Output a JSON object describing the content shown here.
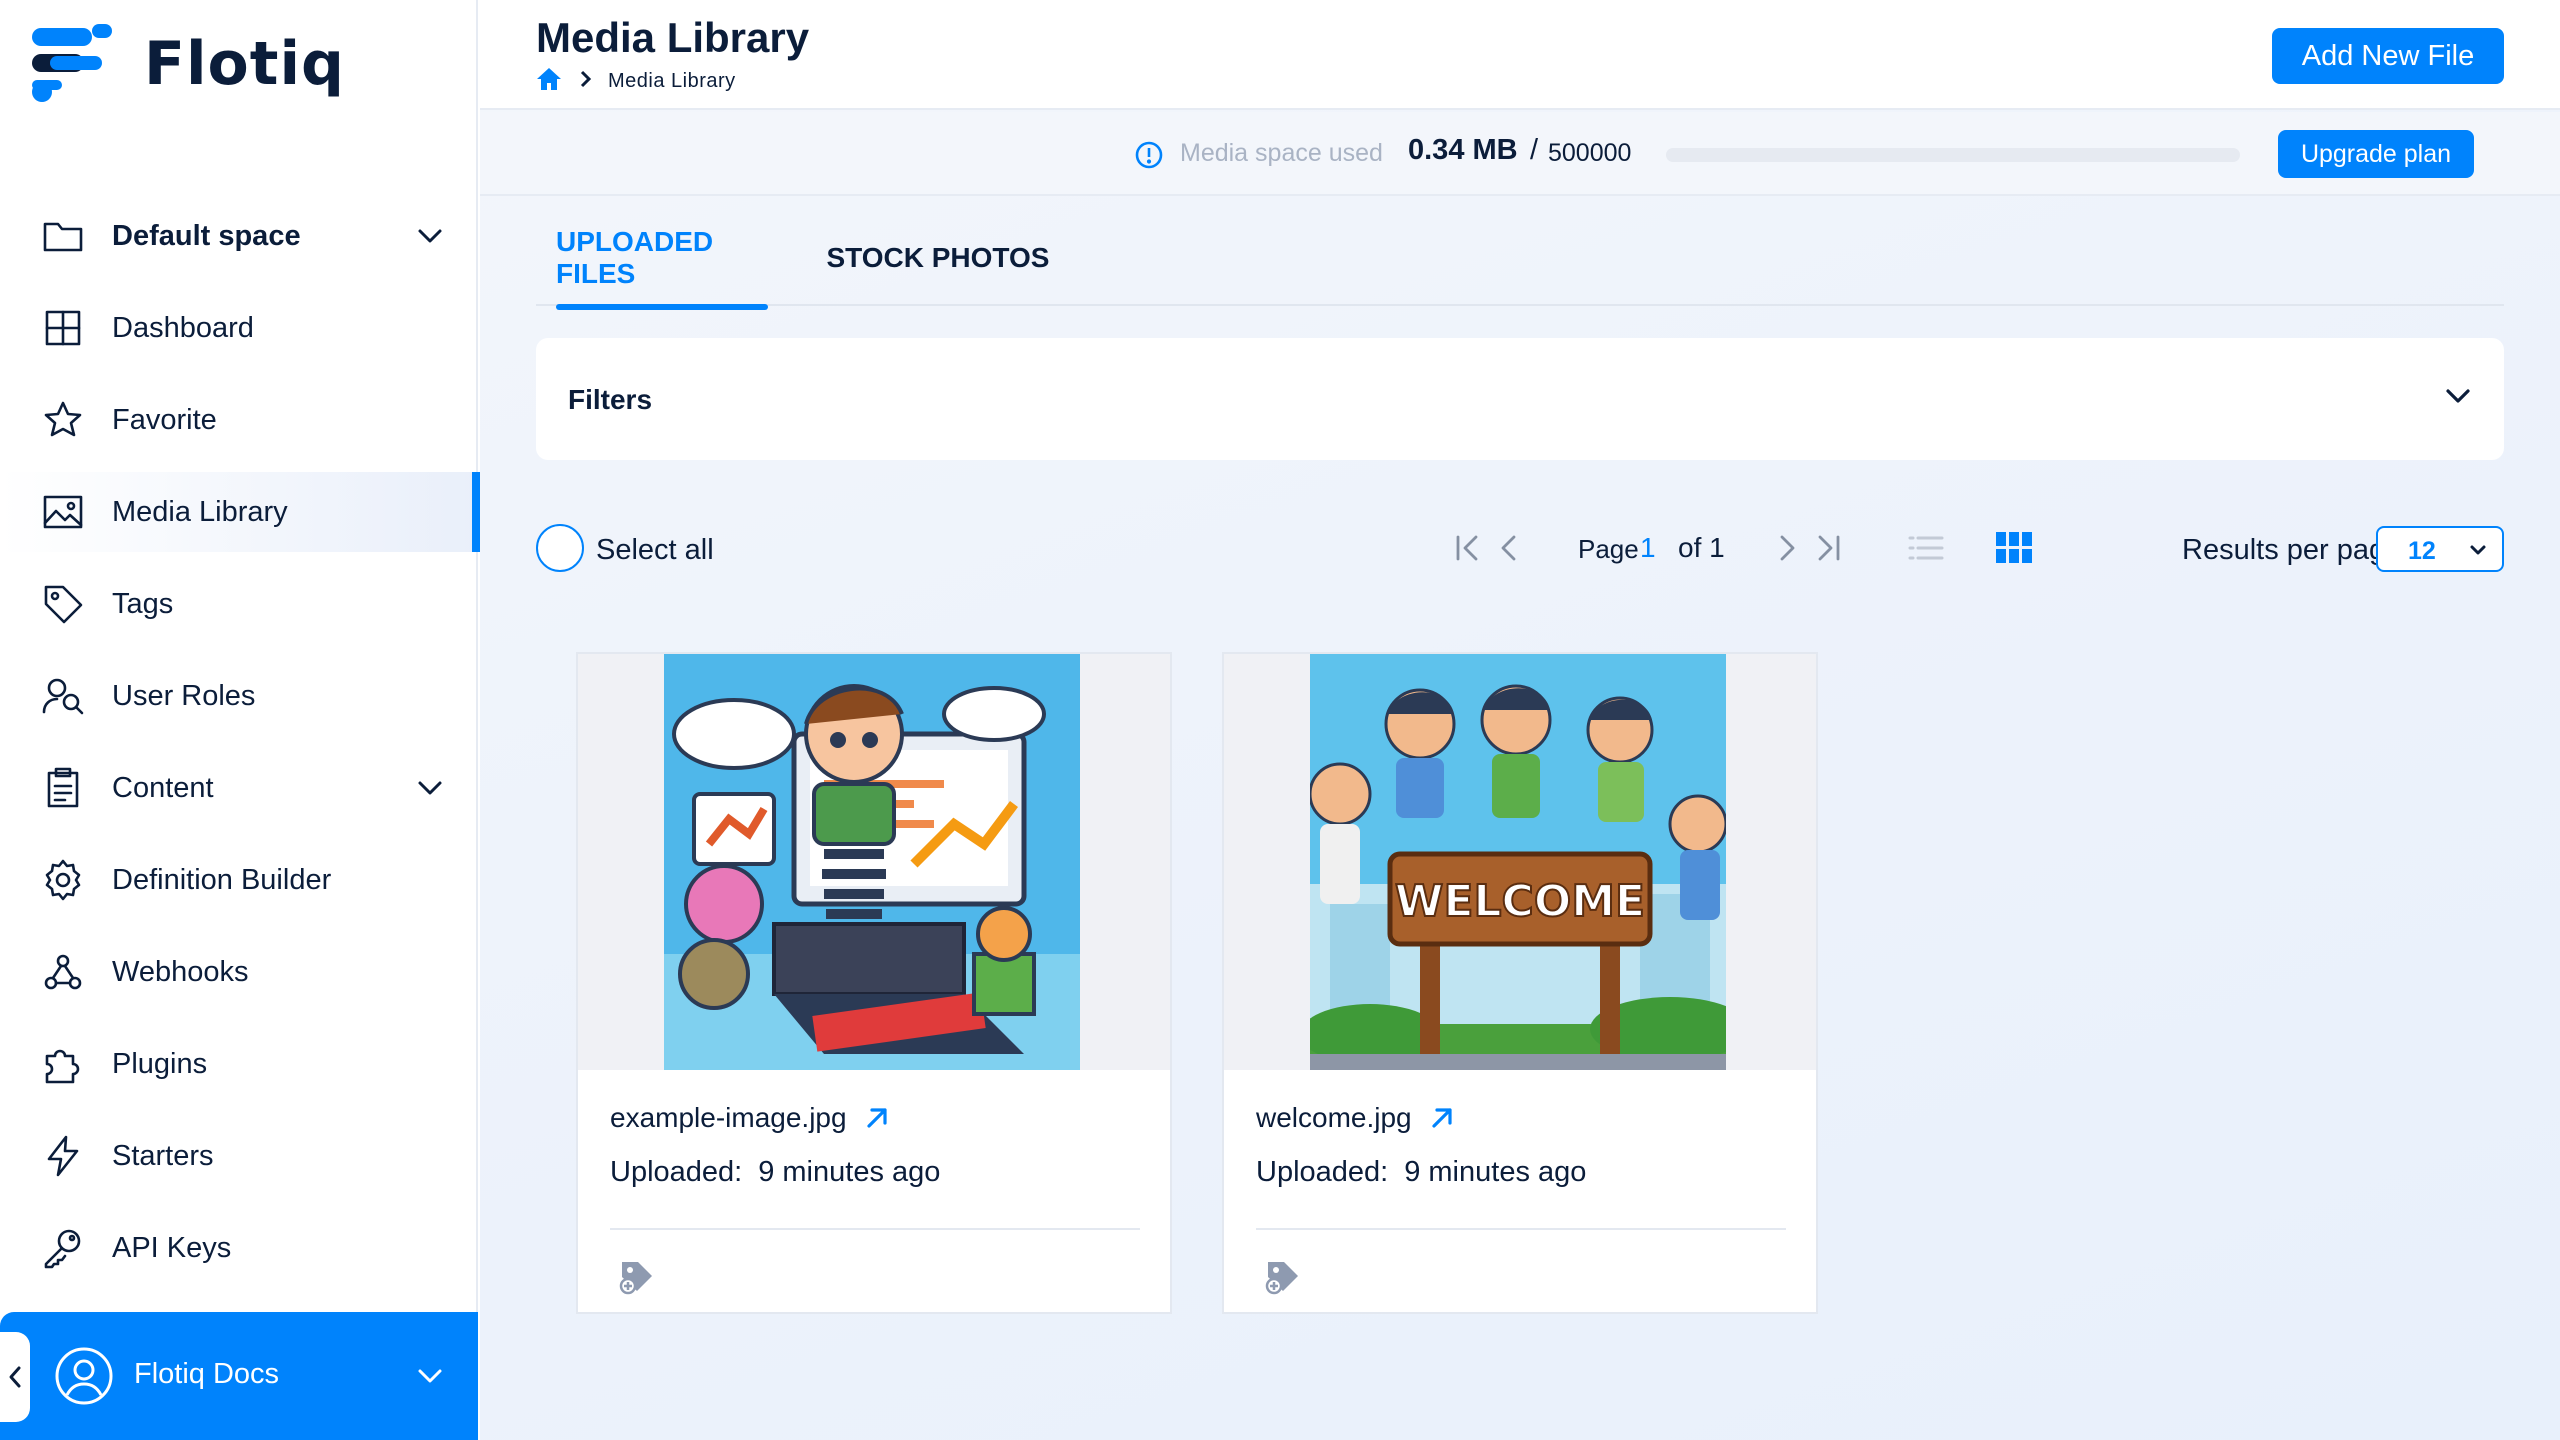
{
  "app": {
    "name": "Flotiq"
  },
  "sidebar": {
    "items": [
      {
        "label": "Default space",
        "icon": "folder-icon",
        "bold": true,
        "expandable": true
      },
      {
        "label": "Dashboard",
        "icon": "grid-icon"
      },
      {
        "label": "Favorite",
        "icon": "star-icon"
      },
      {
        "label": "Media Library",
        "icon": "image-icon",
        "active": true
      },
      {
        "label": "Tags",
        "icon": "tag-icon"
      },
      {
        "label": "User Roles",
        "icon": "users-icon"
      },
      {
        "label": "Content",
        "icon": "clipboard-icon",
        "expandable": true
      },
      {
        "label": "Definition Builder",
        "icon": "gear-icon"
      },
      {
        "label": "Webhooks",
        "icon": "webhook-icon"
      },
      {
        "label": "Plugins",
        "icon": "puzzle-icon"
      },
      {
        "label": "Starters",
        "icon": "lightning-icon"
      },
      {
        "label": "API Keys",
        "icon": "key-icon"
      }
    ],
    "user": {
      "name": "Flotiq Docs"
    }
  },
  "header": {
    "title": "Media Library",
    "breadcrumb": "Media Library",
    "add_button": "Add New File"
  },
  "usage": {
    "label": "Media space used",
    "used": "0.34 MB",
    "slash": "/",
    "total": "500000",
    "fraction": 7e-07,
    "upgrade_button": "Upgrade plan"
  },
  "tabs": [
    {
      "label": "UPLOADED FILES",
      "active": true
    },
    {
      "label": "STOCK PHOTOS",
      "active": false
    }
  ],
  "filters": {
    "label": "Filters"
  },
  "toolbar": {
    "select_all": "Select all",
    "page_label": "Page",
    "page_current": "1",
    "page_of": "of 1",
    "results_label": "Results per page",
    "results_value": "12"
  },
  "files": [
    {
      "name": "example-image.jpg",
      "uploaded_label": "Uploaded:",
      "uploaded_value": "9 minutes ago"
    },
    {
      "name": "welcome.jpg",
      "uploaded_label": "Uploaded:",
      "uploaded_value": "9 minutes ago"
    }
  ],
  "colors": {
    "accent": "#0083fc",
    "text": "#0b1d3a",
    "muted": "#a9b3c4"
  }
}
